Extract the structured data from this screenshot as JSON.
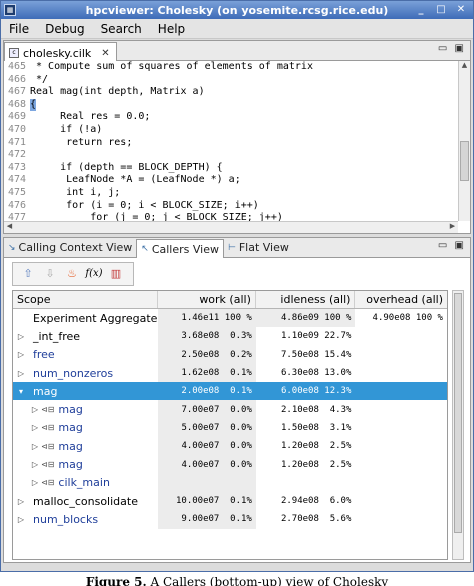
{
  "window": {
    "title": "hpcviewer: Cholesky  (on yosemite.rcsg.rice.edu)",
    "controls": [
      "_",
      "□",
      "✕"
    ]
  },
  "menubar": {
    "items": [
      "File",
      "Debug",
      "Search",
      "Help"
    ]
  },
  "editor": {
    "tab_label": "cholesky.cilk",
    "lines": [
      {
        "n": "465",
        "text": " * Compute sum of squares of elements of matrix"
      },
      {
        "n": "466",
        "text": " */"
      },
      {
        "n": "467",
        "text": "Real mag(int depth, Matrix a)"
      },
      {
        "n": "468",
        "text": "{"
      },
      {
        "n": "469",
        "text": "     Real res = 0.0;"
      },
      {
        "n": "470",
        "text": "     if (!a)"
      },
      {
        "n": "471",
        "text": "      return res;"
      },
      {
        "n": "472",
        "text": ""
      },
      {
        "n": "473",
        "text": "     if (depth == BLOCK_DEPTH) {"
      },
      {
        "n": "474",
        "text": "      LeafNode *A = (LeafNode *) a;"
      },
      {
        "n": "475",
        "text": "      int i, j;"
      },
      {
        "n": "476",
        "text": "      for (i = 0; i < BLOCK_SIZE; i++)"
      },
      {
        "n": "477",
        "text": "          for (j = 0; j < BLOCK_SIZE; j++)"
      }
    ]
  },
  "views": {
    "tabs": [
      "Calling Context View",
      "Callers View",
      "Flat View"
    ],
    "active_tab": "Callers View"
  },
  "table": {
    "columns": [
      "Scope",
      "work (all)",
      "idleness (all)",
      "overhead (all)"
    ],
    "rows": [
      {
        "name": "Experiment Aggregate",
        "indent": 0,
        "expander": "",
        "call": false,
        "link": false,
        "selected": false,
        "work": "1.46e11 100 %",
        "idle": "4.86e09 100 %",
        "over": "4.90e08 100 %"
      },
      {
        "name": "_int_free",
        "indent": 0,
        "expander": "▷",
        "call": false,
        "link": false,
        "selected": false,
        "work": "3.68e08  0.3%",
        "idle": "1.10e09 22.7%",
        "over": ""
      },
      {
        "name": "free",
        "indent": 0,
        "expander": "▷",
        "call": false,
        "link": true,
        "selected": false,
        "work": "2.50e08  0.2%",
        "idle": "7.50e08 15.4%",
        "over": ""
      },
      {
        "name": "num_nonzeros",
        "indent": 0,
        "expander": "▷",
        "call": false,
        "link": true,
        "selected": false,
        "work": "1.62e08  0.1%",
        "idle": "6.30e08 13.0%",
        "over": ""
      },
      {
        "name": "mag",
        "indent": 0,
        "expander": "▾",
        "call": false,
        "link": false,
        "selected": true,
        "work": "2.00e08  0.1%",
        "idle": "6.00e08 12.3%",
        "over": ""
      },
      {
        "name": "mag",
        "indent": 1,
        "expander": "▷",
        "call": true,
        "link": true,
        "selected": false,
        "work": "7.00e07  0.0%",
        "idle": "2.10e08  4.3%",
        "over": ""
      },
      {
        "name": "mag",
        "indent": 1,
        "expander": "▷",
        "call": true,
        "link": true,
        "selected": false,
        "work": "5.00e07  0.0%",
        "idle": "1.50e08  3.1%",
        "over": ""
      },
      {
        "name": "mag",
        "indent": 1,
        "expander": "▷",
        "call": true,
        "link": true,
        "selected": false,
        "work": "4.00e07  0.0%",
        "idle": "1.20e08  2.5%",
        "over": ""
      },
      {
        "name": "mag",
        "indent": 1,
        "expander": "▷",
        "call": true,
        "link": true,
        "selected": false,
        "work": "4.00e07  0.0%",
        "idle": "1.20e08  2.5%",
        "over": ""
      },
      {
        "name": "cilk_main",
        "indent": 1,
        "expander": "▷",
        "call": true,
        "link": true,
        "selected": false,
        "work": "",
        "idle": "",
        "over": ""
      },
      {
        "name": "malloc_consolidate",
        "indent": 0,
        "expander": "▷",
        "call": false,
        "link": false,
        "selected": false,
        "work": "10.00e07  0.1%",
        "idle": "2.94e08  6.0%",
        "over": ""
      },
      {
        "name": "num_blocks",
        "indent": 0,
        "expander": "▷",
        "call": false,
        "link": true,
        "selected": false,
        "work": "9.00e07  0.1%",
        "idle": "2.70e08  5.6%",
        "over": ""
      }
    ]
  },
  "caption": {
    "figure": "Figure 5.",
    "text": "A Callers (bottom-up) view of Cholesky"
  },
  "colors": {
    "selection": "#3296d6",
    "link": "#1f3e9a",
    "titlebar": "#3e6cb8"
  }
}
